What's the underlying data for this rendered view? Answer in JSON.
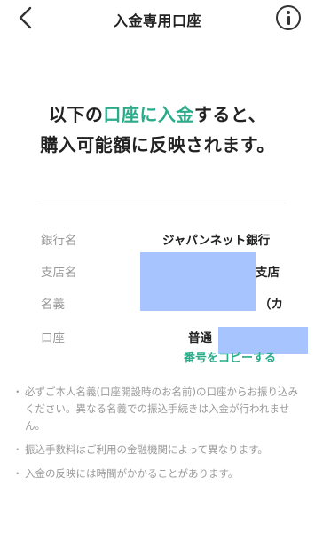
{
  "header": {
    "title": "入金専用口座"
  },
  "headline": {
    "line1_pre": "以下の",
    "line1_accent": "口座に入金",
    "line1_post": "すると、",
    "line2": "購入可能額に反映されます。"
  },
  "account": {
    "bank_label": "銀行名",
    "bank_value": "ジャパンネット銀行",
    "branch_label": "支店名",
    "branch_suffix": "支店",
    "name_label": "名義",
    "name_suffix": "（カ",
    "account_label": "口座",
    "account_type": "普通",
    "copy_label": "番号をコピーする"
  },
  "notes": [
    "必ずご本人名義(口座開設時のお名前)の口座からお振り込みください。異なる名義での振込手続きは入金が行われません。",
    "振込手数料はご利用の金融機関によって異なります。",
    "入金の反映には時間がかかることがあります。"
  ],
  "colors": {
    "accent": "#2bab8a",
    "mask": "#a7c4ff"
  }
}
